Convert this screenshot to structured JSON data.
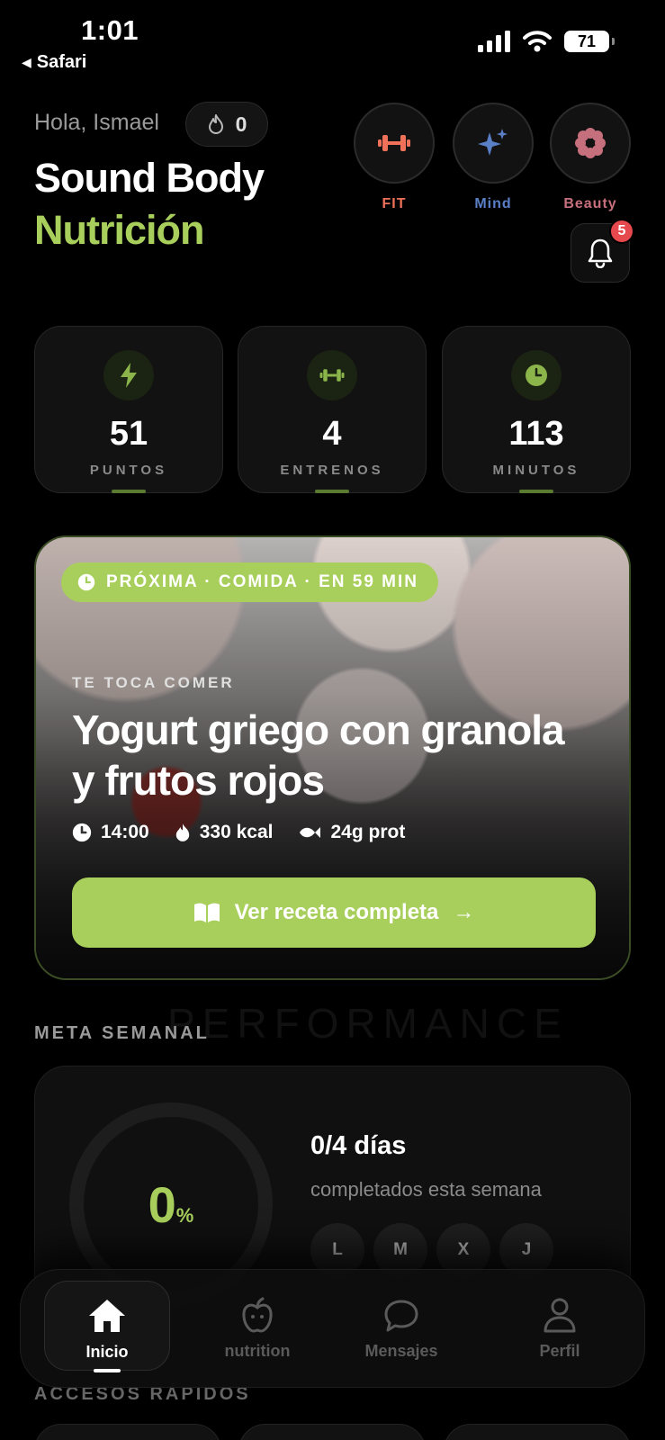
{
  "status": {
    "time": "1:01",
    "back_label": "Safari",
    "battery": "71"
  },
  "header": {
    "greeting": "Hola, Ismael",
    "streak_count": "0",
    "title_line1": "Sound Body",
    "title_line2": "Nutrición",
    "notification_count": "5"
  },
  "categories": [
    {
      "label": "FIT",
      "icon": "dumbbell-icon",
      "color": "#f0715a"
    },
    {
      "label": "Mind",
      "icon": "sparkles-icon",
      "color": "#5b7fc6"
    },
    {
      "label": "Beauty",
      "icon": "flower-icon",
      "color": "#c5707c"
    }
  ],
  "stats": [
    {
      "value": "51",
      "caption": "PUNTOS",
      "icon": "bolt-icon"
    },
    {
      "value": "4",
      "caption": "ENTRENOS",
      "icon": "dumbbell-icon"
    },
    {
      "value": "113",
      "caption": "MINUTOS",
      "icon": "clock-icon"
    }
  ],
  "hero": {
    "pill": "PRÓXIMA · COMIDA · EN 59 MIN",
    "kicker": "TE TOCA COMER",
    "title": "Yogurt griego con granola y frutos rojos",
    "time": "14:00",
    "kcal": "330 kcal",
    "protein": "24g prot",
    "button": "Ver receta completa"
  },
  "watermark": "PERFORMANCE",
  "weekly": {
    "section_title": "META SEMANAL",
    "percent": "0",
    "percent_unit": "%",
    "count": "0/4 días",
    "subtitle": "completados esta semana",
    "days": [
      "L",
      "M",
      "X",
      "J"
    ]
  },
  "quick_access_title": "ACCESOS RÁPIDOS",
  "nav": {
    "items": [
      {
        "label": "Inicio",
        "icon": "home-icon",
        "active": true
      },
      {
        "label": "nutrition",
        "icon": "apple-icon",
        "active": false
      },
      {
        "label": "Mensajes",
        "icon": "chat-icon",
        "active": false
      },
      {
        "label": "Perfil",
        "icon": "user-icon",
        "active": false
      }
    ]
  },
  "colors": {
    "accent": "#a8cf5c",
    "background": "#000000",
    "badge": "#e5484d"
  }
}
